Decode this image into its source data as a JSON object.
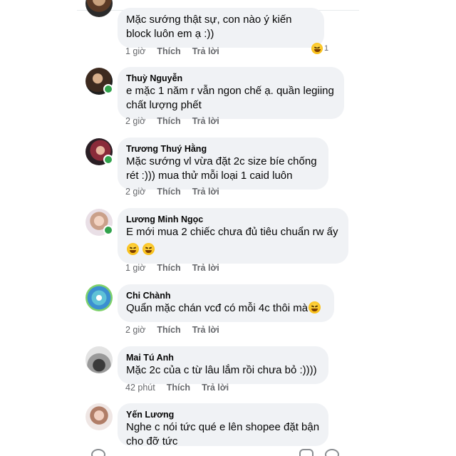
{
  "comments": [
    {
      "name": "",
      "text": "Mặc sướng thật sự, con nào ý kiến block luôn em ạ :))",
      "time": "1 giờ",
      "like": "Thích",
      "reply": "Trả lời",
      "reaction_count": "1",
      "online": false
    },
    {
      "name": "Thuỳ Nguyễn",
      "text": "e mặc 1 năm r vẫn ngon chế ạ. quần legiing chất lượng phết",
      "time": "2 giờ",
      "like": "Thích",
      "reply": "Trả lời",
      "online": true
    },
    {
      "name": "Trương Thuý Hằng",
      "text": "Mặc sướng vl vừa đặt 2c size bíe chống rét :))) mua thử mỗi loại 1 caid luôn",
      "time": "2 giờ",
      "like": "Thích",
      "reply": "Trả lời",
      "online": true
    },
    {
      "name": "Lương Minh Ngọc",
      "text": "E mới mua 2 chiếc chưa đủ tiêu chuẩn rw ấy",
      "time": "1 giờ",
      "like": "Thích",
      "reply": "Trả lời",
      "online": true
    },
    {
      "name": "Chi Chành",
      "text": "Quẩn mặc chán vcđ có mỗi 4c thôi mà",
      "time": "2 giờ",
      "like": "Thích",
      "reply": "Trả lời",
      "online": false
    },
    {
      "name": "Mai Tú Anh",
      "text": "Mặc 2c của c từ lâu lắm rồi chưa bỏ :))))",
      "time": "42 phút",
      "like": "Thích",
      "reply": "Trả lời",
      "online": false
    },
    {
      "name": "Yến Lương",
      "text": "Nghe c nói tức qué e lên shopee đặt bận cho đỡ tức",
      "online": false
    }
  ],
  "colors": {
    "bubble": "#f0f2f5",
    "meta": "#65676b",
    "online": "#31a24c"
  },
  "icons": [
    "laughing-emoji-icon",
    "online-status-dot"
  ]
}
